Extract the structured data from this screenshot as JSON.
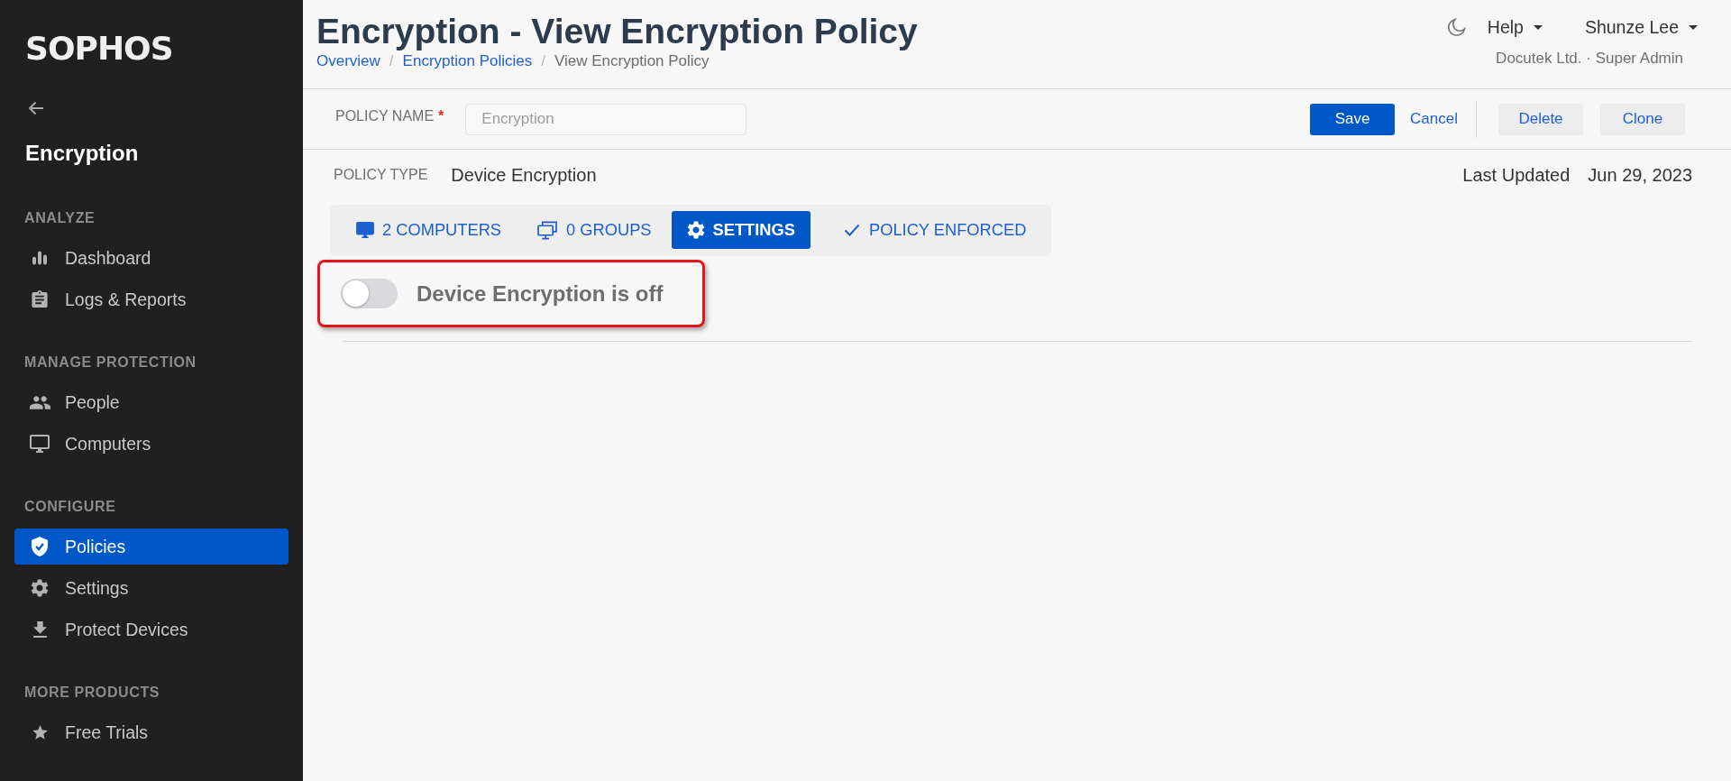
{
  "sidebar": {
    "logo": "SOPHOS",
    "title": "Encryption",
    "sections": [
      {
        "heading": "ANALYZE",
        "items": [
          {
            "label": "Dashboard",
            "selected": false
          },
          {
            "label": "Logs & Reports",
            "selected": false
          }
        ]
      },
      {
        "heading": "MANAGE PROTECTION",
        "items": [
          {
            "label": "People",
            "selected": false
          },
          {
            "label": "Computers",
            "selected": false
          }
        ]
      },
      {
        "heading": "CONFIGURE",
        "items": [
          {
            "label": "Policies",
            "selected": true
          },
          {
            "label": "Settings",
            "selected": false
          },
          {
            "label": "Protect Devices",
            "selected": false
          }
        ]
      },
      {
        "heading": "MORE PRODUCTS",
        "items": [
          {
            "label": "Free Trials",
            "selected": false
          }
        ]
      }
    ]
  },
  "header": {
    "title": "Encryption - View Encryption Policy",
    "breadcrumb": {
      "separator": "/",
      "items": [
        {
          "label": "Overview",
          "kind": "link"
        },
        {
          "label": "Encryption Policies",
          "kind": "link"
        },
        {
          "label": "View Encryption Policy",
          "kind": "current"
        }
      ]
    },
    "help": "Help",
    "user": "Shunze Lee",
    "account": "Docutek Ltd. · Super Admin"
  },
  "policy_name": {
    "label": "POLICY NAME",
    "required_mark": "*",
    "placeholder": "Encryption"
  },
  "actions": [
    {
      "label": "Save",
      "kind": "primary"
    },
    {
      "label": "Cancel",
      "kind": "link"
    },
    {
      "label": "Delete",
      "kind": "secondary"
    },
    {
      "label": "Clone",
      "kind": "secondary"
    }
  ],
  "policy_type": {
    "label": "POLICY TYPE",
    "value": "Device Encryption"
  },
  "last_updated": {
    "label": "Last Updated",
    "value": "Jun 29, 2023"
  },
  "tabs": [
    {
      "label": "2 COMPUTERS",
      "selected": false
    },
    {
      "label": "0 GROUPS",
      "selected": false
    },
    {
      "label": "SETTINGS",
      "selected": true
    }
  ],
  "enforcement": {
    "label": "POLICY ENFORCED"
  },
  "settings": {
    "toggle": {
      "label": "Device Encryption is off",
      "on": false,
      "highlighted": true
    }
  }
}
